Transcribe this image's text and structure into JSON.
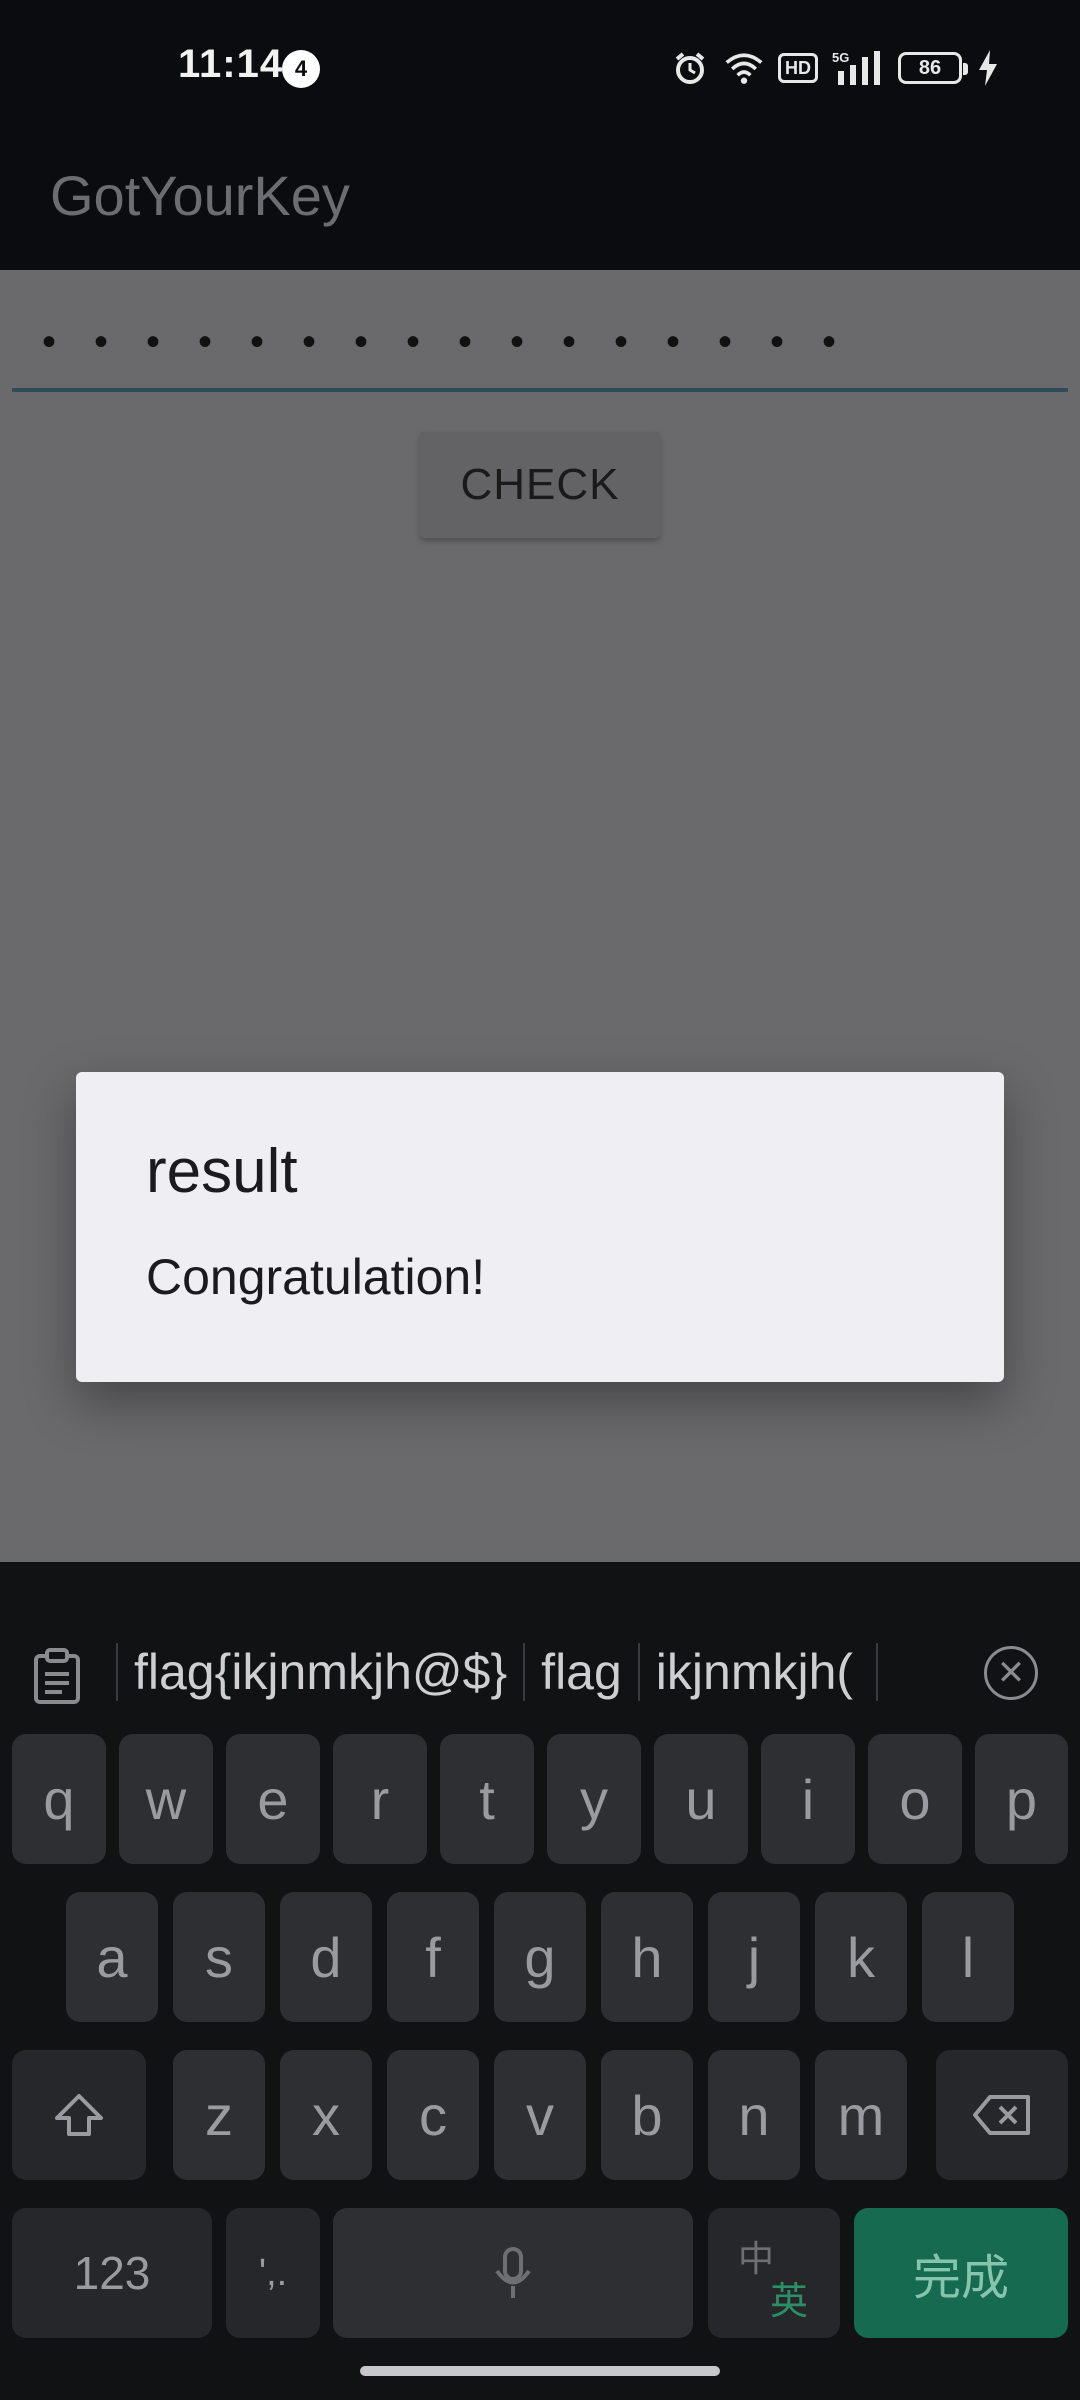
{
  "status_bar": {
    "time": "11:14",
    "notification_count": "4",
    "hd_label": "HD",
    "network_label": "5G",
    "battery_level": "86"
  },
  "app": {
    "title": "GotYourKey"
  },
  "form": {
    "password_dots": "••••••••••••••••",
    "check_label": "CHECK"
  },
  "dialog": {
    "title": "result",
    "message": "Congratulation!"
  },
  "keyboard": {
    "suggestions": [
      "flag{ikjnmkjh@$}",
      "flag",
      "ikjnmkjh("
    ],
    "row1": [
      "q",
      "w",
      "e",
      "r",
      "t",
      "y",
      "u",
      "i",
      "o",
      "p"
    ],
    "row2": [
      "a",
      "s",
      "d",
      "f",
      "g",
      "h",
      "j",
      "k",
      "l"
    ],
    "row3": [
      "z",
      "x",
      "c",
      "v",
      "b",
      "n",
      "m"
    ],
    "numbers_label": "123",
    "punct_label": "',.",
    "lang_top": "中",
    "lang_bottom": "英",
    "done_label": "完成",
    "accent_color": "#166a4f"
  }
}
